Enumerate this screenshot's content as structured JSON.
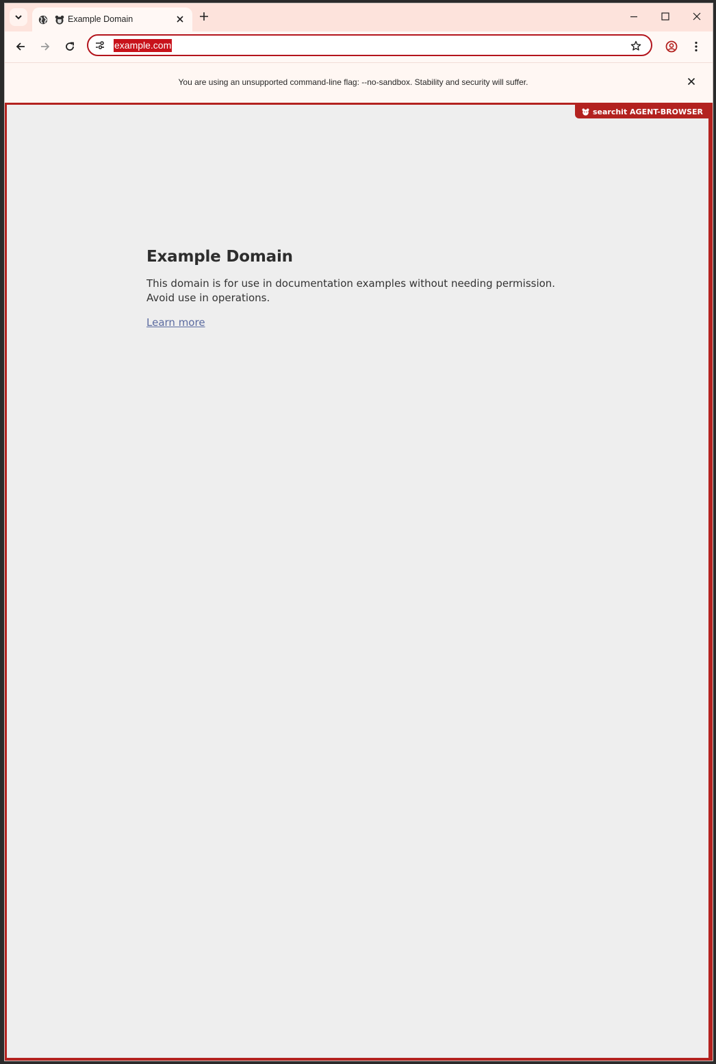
{
  "tab": {
    "title": "Example Domain"
  },
  "omnibox": {
    "url": "example.com"
  },
  "infobar": {
    "message": "You are using an unsupported command-line flag: --no-sandbox. Stability and security will suffer."
  },
  "agent_badge": {
    "label": "searchit AGENT-BROWSER"
  },
  "page": {
    "heading": "Example Domain",
    "body": "This domain is for use in documentation examples without needing permission. Avoid use in operations.",
    "link": "Learn more"
  },
  "icons": [
    "tab-search-icon",
    "globe-icon",
    "bear-favicon-icon",
    "close-icon",
    "plus-icon",
    "minimize-icon",
    "maximize-icon",
    "back-icon",
    "forward-icon",
    "reload-icon",
    "site-info-icon",
    "star-icon",
    "profile-icon",
    "menu-icon"
  ],
  "colors": {
    "accent": "#b3221f",
    "tabstrip": "#fde3dc",
    "toolbar": "#fff8f5",
    "page_bg": "#eeeeee",
    "link": "#5b6ba0"
  }
}
